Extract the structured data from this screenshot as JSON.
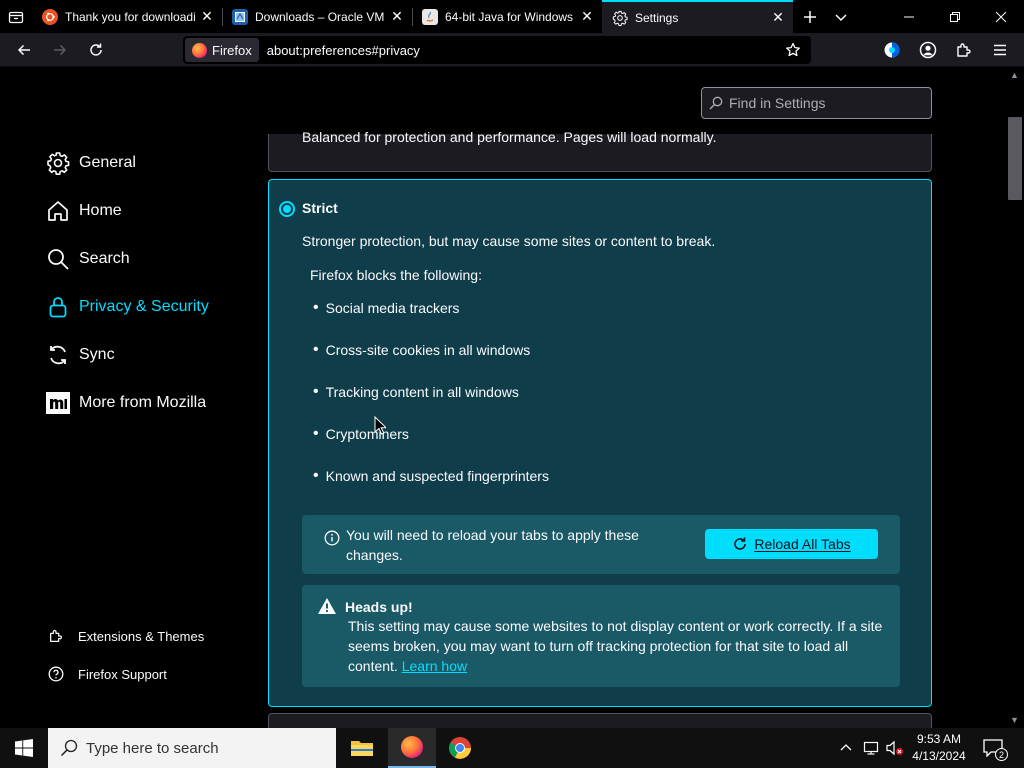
{
  "tabs": [
    {
      "title": "Thank you for downloadi",
      "favicon": "ubuntu-icon"
    },
    {
      "title": "Downloads – Oracle VM V",
      "favicon": "virtualbox-icon"
    },
    {
      "title": "64-bit Java for Windows",
      "favicon": "java-icon"
    },
    {
      "title": "Settings",
      "favicon": "gear-icon",
      "active": true
    }
  ],
  "urlbar": {
    "identity": "Firefox",
    "url": "about:preferences#privacy"
  },
  "find": {
    "placeholder": "Find in Settings"
  },
  "sidebar": {
    "categories": [
      {
        "label": "General",
        "icon": "gear-icon"
      },
      {
        "label": "Home",
        "icon": "home-icon"
      },
      {
        "label": "Search",
        "icon": "search-icon"
      },
      {
        "label": "Privacy & Security",
        "icon": "lock-icon",
        "selected": true
      },
      {
        "label": "Sync",
        "icon": "sync-icon"
      },
      {
        "label": "More from Mozilla",
        "icon": "mozilla-icon"
      }
    ],
    "footer": [
      {
        "label": "Extensions & Themes",
        "icon": "puzzle-icon"
      },
      {
        "label": "Firefox Support",
        "icon": "help-icon"
      }
    ]
  },
  "balanced": {
    "desc": "Balanced for protection and performance. Pages will load normally."
  },
  "strict": {
    "title": "Strict",
    "desc": "Stronger protection, but may cause some sites or content to break.",
    "blocks_label": "Firefox blocks the following:",
    "items": [
      "Social media trackers",
      "Cross-site cookies in all windows",
      "Tracking content in all windows",
      "Cryptominers",
      "Known and suspected fingerprinters"
    ]
  },
  "reload": {
    "message": "You will need to reload your tabs to apply these changes.",
    "button": "Reload All Tabs"
  },
  "warning": {
    "title": "Heads up!",
    "message": "This setting may cause some websites to not display content or work correctly. If a site seems broken, you may want to turn off tracking protection for that site to load all content.",
    "link": "Learn how"
  },
  "taskbar": {
    "search_placeholder": "Type here to search",
    "time": "9:53 AM",
    "date": "4/13/2024",
    "notification_count": "2"
  },
  "colors": {
    "accent": "#00ddff",
    "strict_bg": "#0f3d4a",
    "notice_bg": "#1a5966"
  }
}
